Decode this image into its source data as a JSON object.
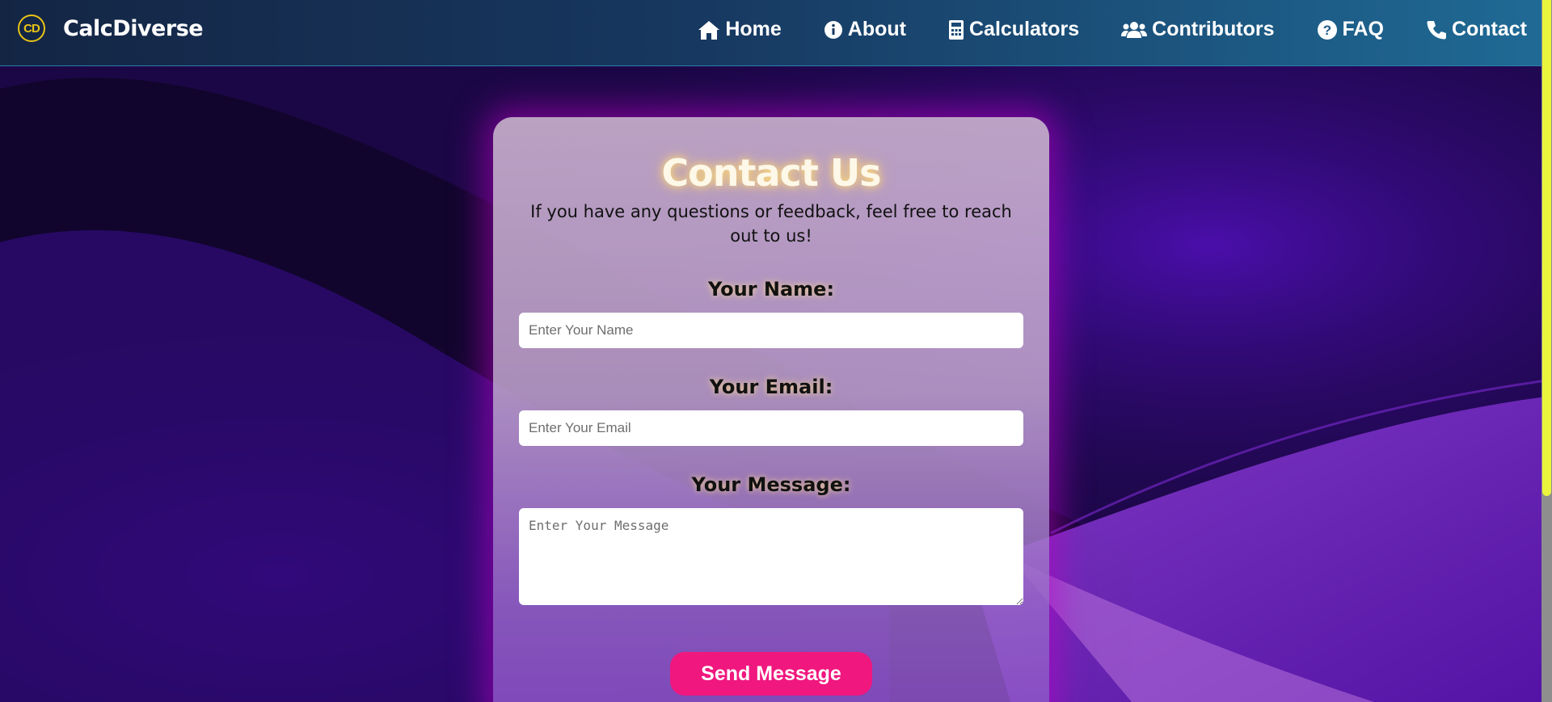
{
  "brand": {
    "logo_initials": "CD",
    "name": "CalcDiverse"
  },
  "nav": {
    "items": [
      {
        "label": "Home",
        "icon": "home-icon"
      },
      {
        "label": "About",
        "icon": "info-icon"
      },
      {
        "label": "Calculators",
        "icon": "calculator-icon"
      },
      {
        "label": "Contributors",
        "icon": "users-icon"
      },
      {
        "label": "FAQ",
        "icon": "question-icon"
      },
      {
        "label": "Contact",
        "icon": "phone-icon"
      }
    ]
  },
  "contact": {
    "title": "Contact Us",
    "subtitle": "If you have any questions or feedback, feel free to reach out to us!",
    "name_label": "Your Name:",
    "name_placeholder": "Enter Your Name",
    "name_value": "",
    "email_label": "Your Email:",
    "email_placeholder": "Enter Your Email",
    "email_value": "",
    "message_label": "Your Message:",
    "message_placeholder": "Enter Your Message",
    "message_value": "",
    "submit_label": "Send Message"
  },
  "colors": {
    "accent": "#f0177e",
    "logo": "#e8c417",
    "scrollbar_thumb": "#ebf43c"
  }
}
